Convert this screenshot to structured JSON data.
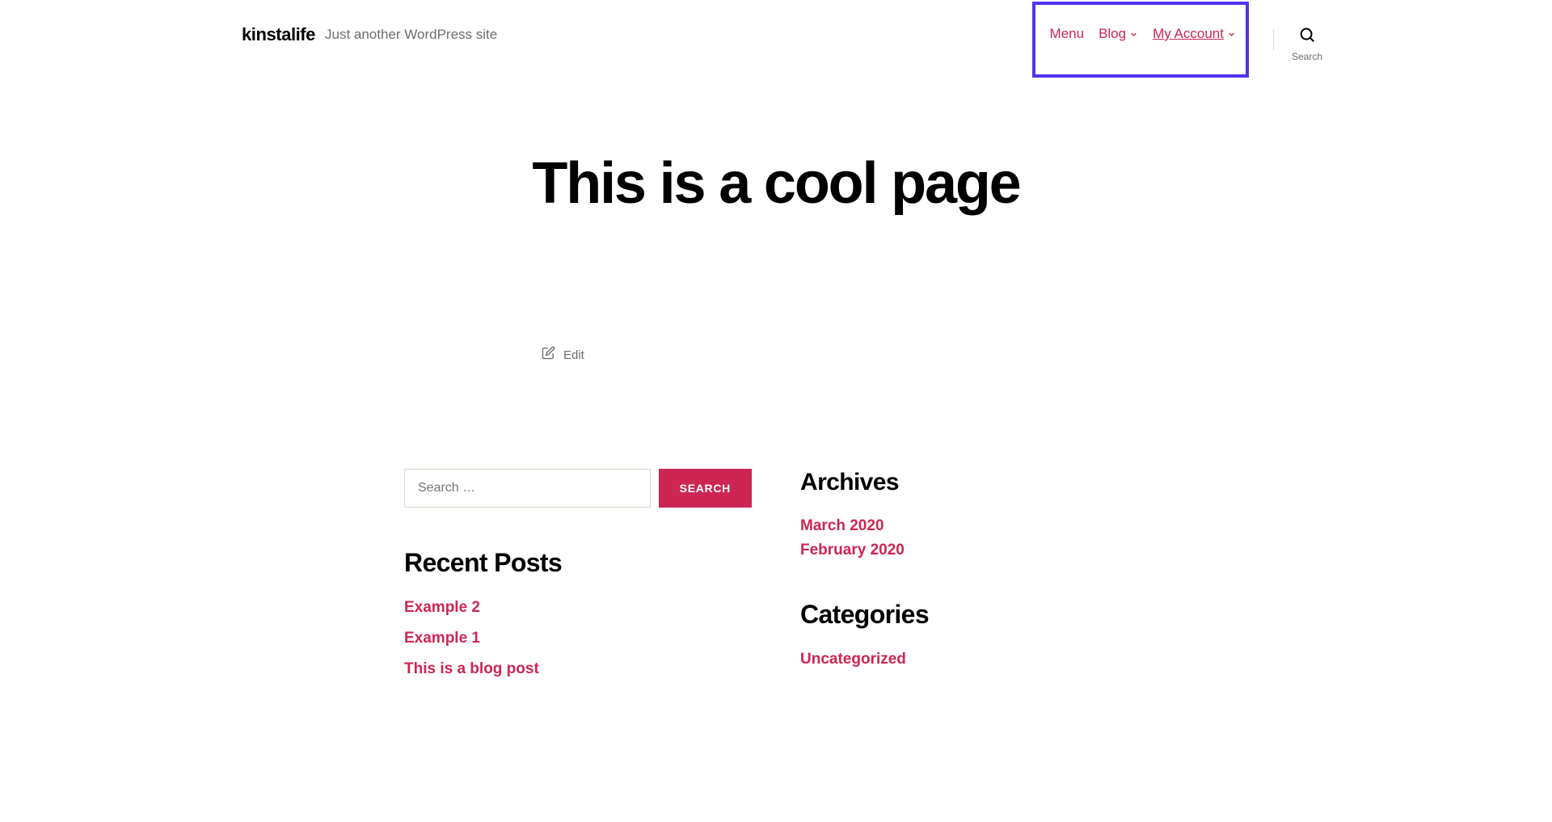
{
  "header": {
    "site_title": "kinstalife",
    "tagline": "Just another WordPress site"
  },
  "nav": {
    "items": [
      {
        "label": "Menu",
        "has_submenu": false
      },
      {
        "label": "Blog",
        "has_submenu": true
      },
      {
        "label": "My Account",
        "has_submenu": true
      }
    ],
    "search_label": "Search"
  },
  "page": {
    "title": "This is a cool page",
    "edit_label": "Edit"
  },
  "search_widget": {
    "placeholder": "Search …",
    "button": "SEARCH"
  },
  "recent_posts": {
    "title": "Recent Posts",
    "items": [
      "Example 2",
      "Example 1",
      "This is a blog post"
    ]
  },
  "archives": {
    "title": "Archives",
    "items": [
      "March 2020",
      "February 2020"
    ]
  },
  "categories": {
    "title": "Categories",
    "items": [
      "Uncategorized"
    ]
  }
}
